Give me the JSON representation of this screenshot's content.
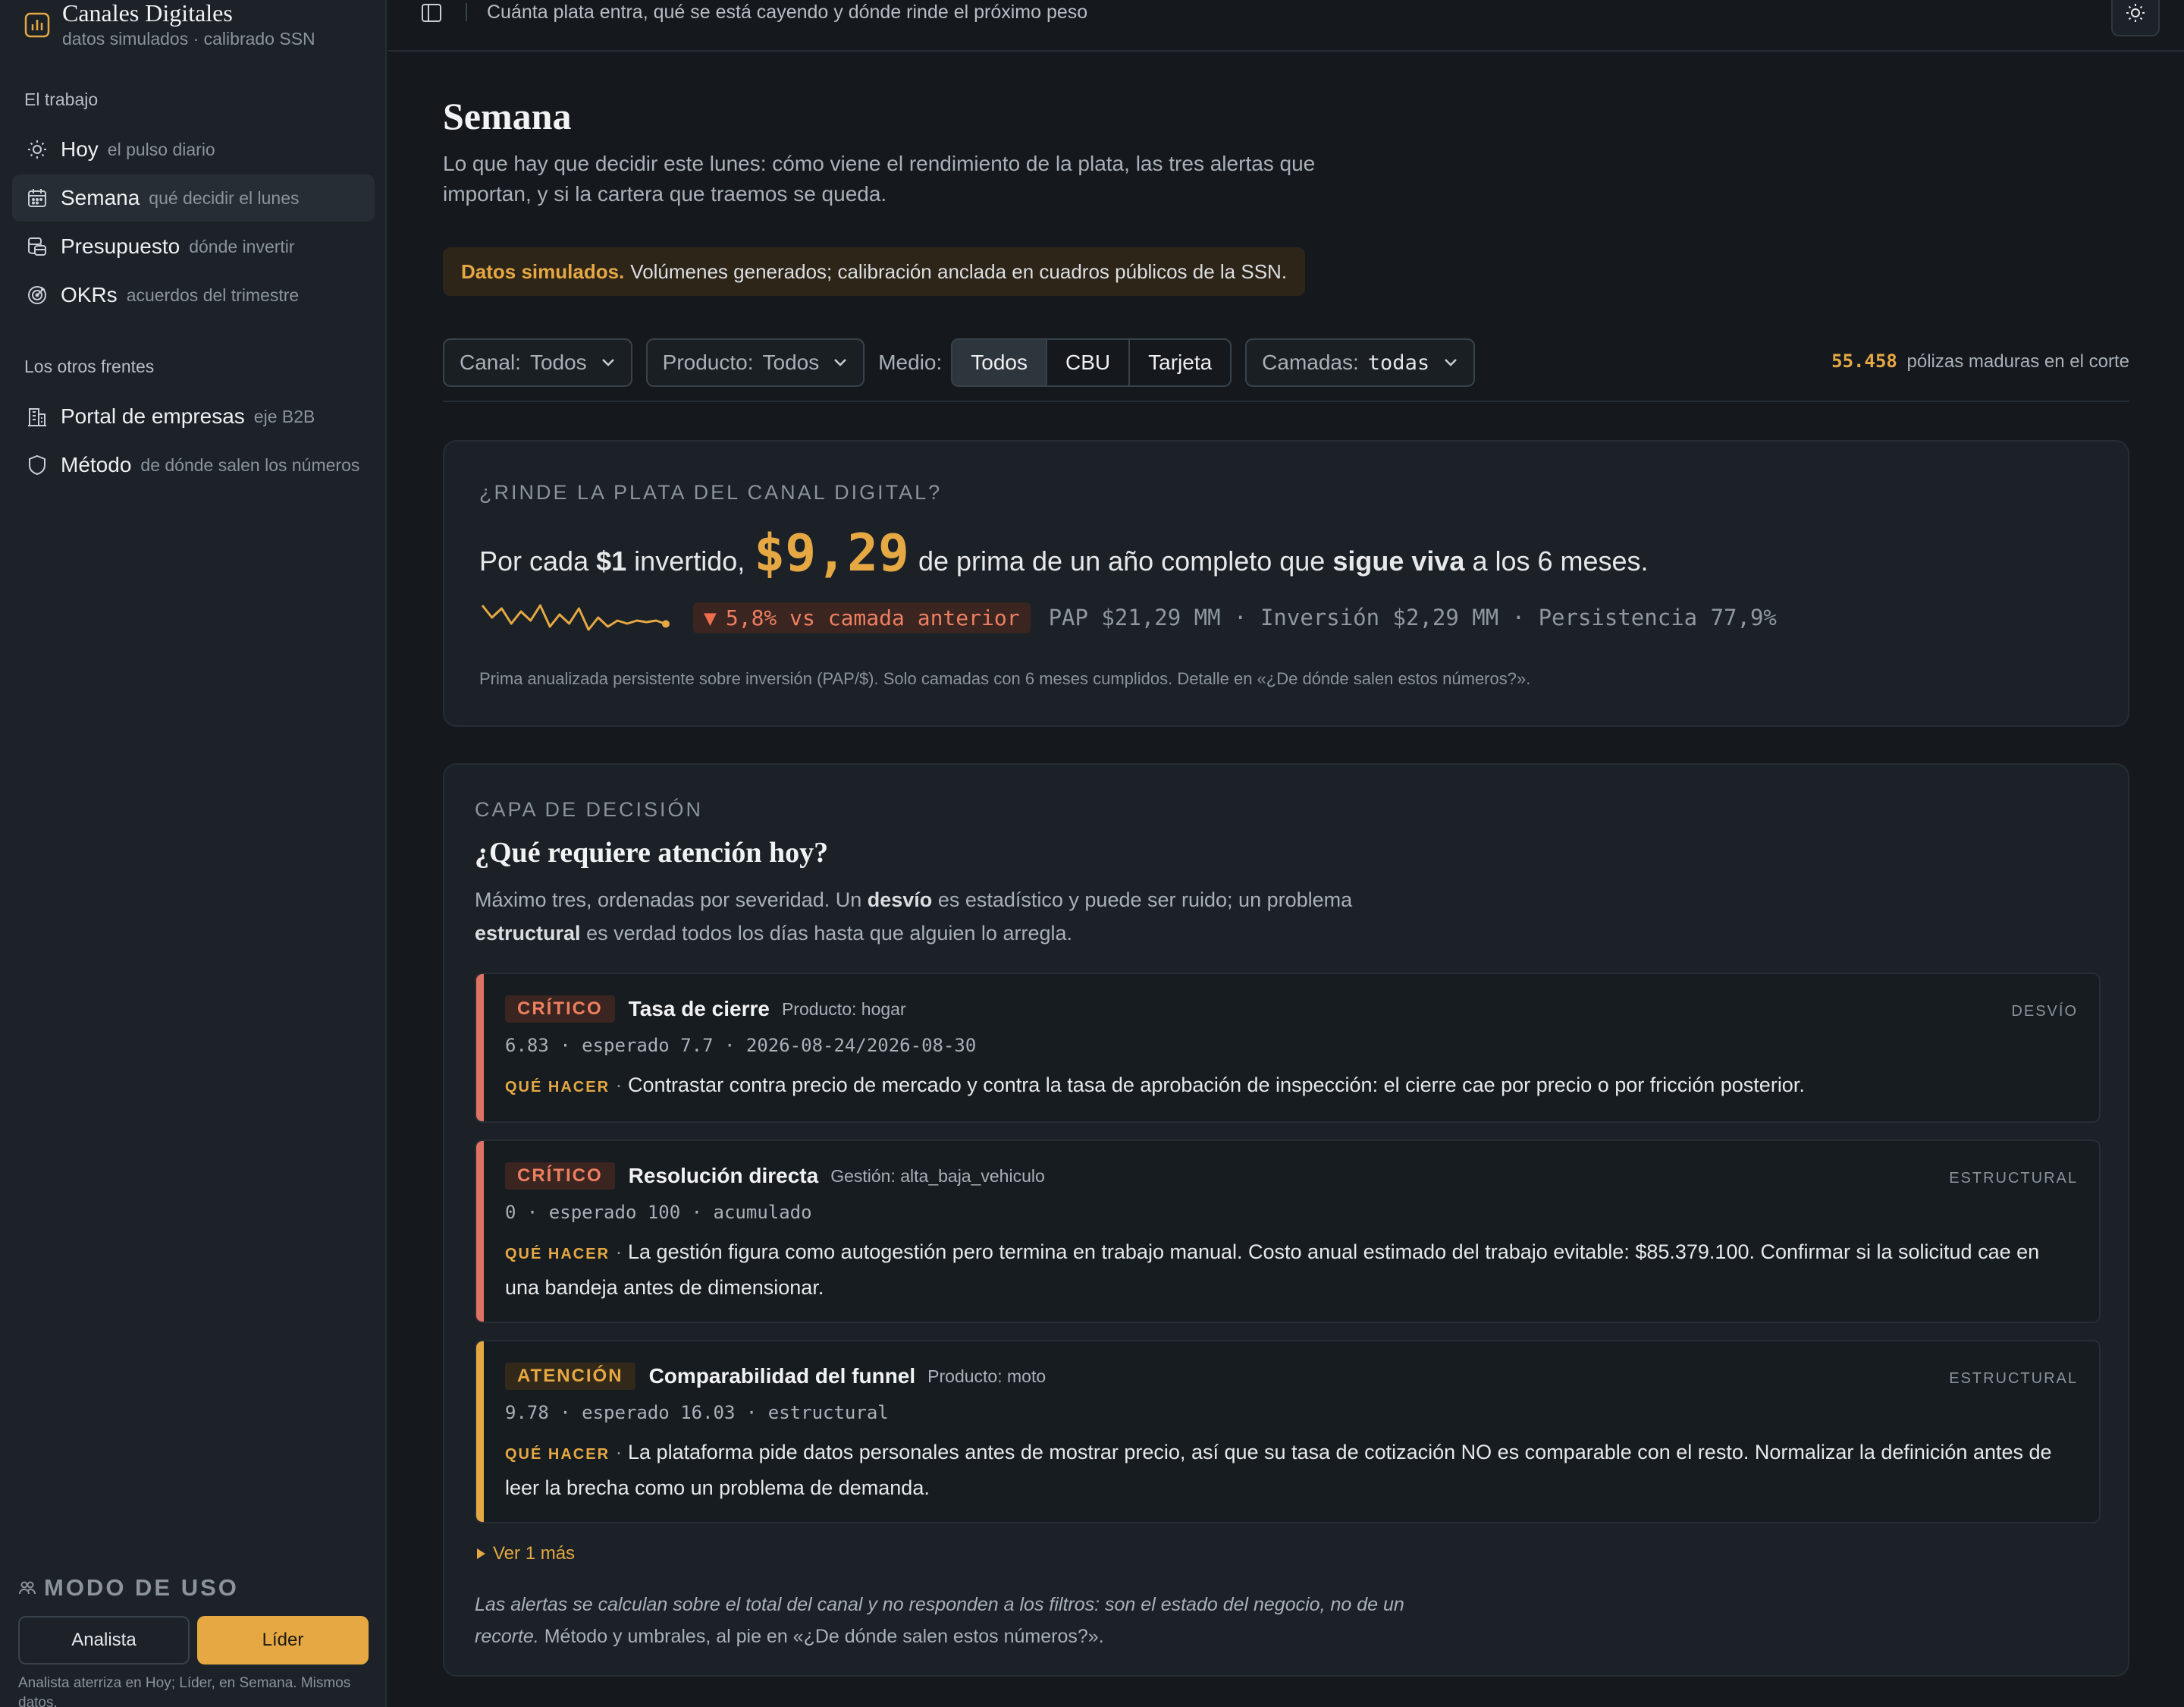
{
  "app": {
    "title": "Canales Digitales",
    "subtitle": "datos simulados · calibrado SSN"
  },
  "sidebar": {
    "section_work": "El trabajo",
    "section_other": "Los otros frentes",
    "items": [
      {
        "label": "Hoy",
        "hint": "el pulso diario",
        "icon": "sun-icon"
      },
      {
        "label": "Semana",
        "hint": "qué decidir el lunes",
        "icon": "calendar-icon"
      },
      {
        "label": "Presupuesto",
        "hint": "dónde invertir",
        "icon": "coins-icon"
      },
      {
        "label": "OKRs",
        "hint": "acuerdos del trimestre",
        "icon": "target-icon"
      },
      {
        "label": "Portal de empresas",
        "hint": "eje B2B",
        "icon": "building-icon"
      },
      {
        "label": "Método",
        "hint": "de dónde salen los números",
        "icon": "shield-icon"
      }
    ],
    "mode": {
      "title": "MODO DE USO",
      "analista": "Analista",
      "lider": "Líder",
      "note": "Analista aterriza en Hoy; Líder, en Semana. Mismos datos."
    }
  },
  "topbar": {
    "text": "Cuánta plata entra, qué se está cayendo y dónde rinde el próximo peso"
  },
  "page": {
    "title": "Semana",
    "description": "Lo que hay que decidir este lunes: cómo viene el rendimiento de la plata, las tres alertas que importan, y si la cartera que traemos se queda.",
    "banner_bold": "Datos simulados.",
    "banner_text": "Volúmenes generados; calibración anclada en cuadros públicos de la SSN."
  },
  "filters": {
    "canal_label": "Canal:",
    "canal_value": "Todos",
    "producto_label": "Producto:",
    "producto_value": "Todos",
    "medio_label": "Medio:",
    "medio_options": [
      "Todos",
      "CBU",
      "Tarjeta"
    ],
    "medio_selected": "Todos",
    "camadas_label": "Camadas:",
    "camadas_value": "todas",
    "policies_count": "55.458",
    "policies_text": "pólizas maduras en el corte"
  },
  "rinde": {
    "eyebrow": "¿RINDE LA PLATA DEL CANAL DIGITAL?",
    "h_pre": "Por cada",
    "h_amount": "$1",
    "h_mid": "invertido,",
    "h_value": "$9,29",
    "h_post1": "de prima de un año completo que",
    "h_bold": "sigue viva",
    "h_post2": "a los 6 meses.",
    "delta": "5,8% vs camada anterior",
    "metrics": "PAP $21,29 MM · Inversión $2,29 MM · Persistencia 77,9%",
    "footnote": "Prima anualizada persistente sobre inversión (PAP/$). Solo camadas con 6 meses cumplidos. Detalle en «¿De dónde salen estos números?».",
    "sparkline": [
      9.9,
      9.5,
      9.8,
      9.3,
      9.7,
      9.4,
      9.9,
      9.2,
      9.6,
      9.3,
      9.8,
      9.1,
      9.5,
      9.2,
      9.4,
      9.3,
      9.4,
      9.35,
      9.4,
      9.29
    ],
    "accent": "#e5a843"
  },
  "decision": {
    "eyebrow": "CAPA DE DECISIÓN",
    "title": "¿Qué requiere atención hoy?",
    "desc_1": "Máximo tres, ordenadas por severidad. Un",
    "desc_b1": "desvío",
    "desc_2": "es estadístico y puede ser ruido; un problema",
    "desc_b2": "estructural",
    "desc_3": "es verdad todos los días hasta que alguien lo arregla.",
    "que_hacer": "QUÉ HACER",
    "alerts": [
      {
        "severity": "CRÍTICO",
        "title": "Tasa de cierre",
        "context": "Producto: hogar",
        "type": "DESVÍO",
        "stats": "6.83 · esperado 7.7 · 2026-08-24/2026-08-30",
        "action": "Contrastar contra precio de mercado y contra la tasa de aprobación de inspección: el cierre cae por precio o por fricción posterior."
      },
      {
        "severity": "CRÍTICO",
        "title": "Resolución directa",
        "context": "Gestión: alta_baja_vehiculo",
        "type": "ESTRUCTURAL",
        "stats": "0 · esperado 100 · acumulado",
        "action": "La gestión figura como autogestión pero termina en trabajo manual. Costo anual estimado del trabajo evitable: $85.379.100. Confirmar si la solicitud cae en una bandeja antes de dimensionar."
      },
      {
        "severity": "ATENCIÓN",
        "title": "Comparabilidad del funnel",
        "context": "Producto: moto",
        "type": "ESTRUCTURAL",
        "stats": "9.78 · esperado 16.03 · estructural",
        "action": "La plataforma pide datos personales antes de mostrar precio, así que su tasa de cotización NO es comparable con el resto. Normalizar la definición antes de leer la brecha como un problema de demanda."
      }
    ],
    "ver_mas": "Ver 1 más",
    "closing_italic": "Las alertas se calculan sobre el total del canal y no responden a los filtros: son el estado del negocio, no de un recorte.",
    "closing_rest": "Método y umbrales, al pie en «¿De dónde salen estos números?».",
    "colors": {
      "critical": "#e07262",
      "attention": "#e5a843"
    }
  }
}
